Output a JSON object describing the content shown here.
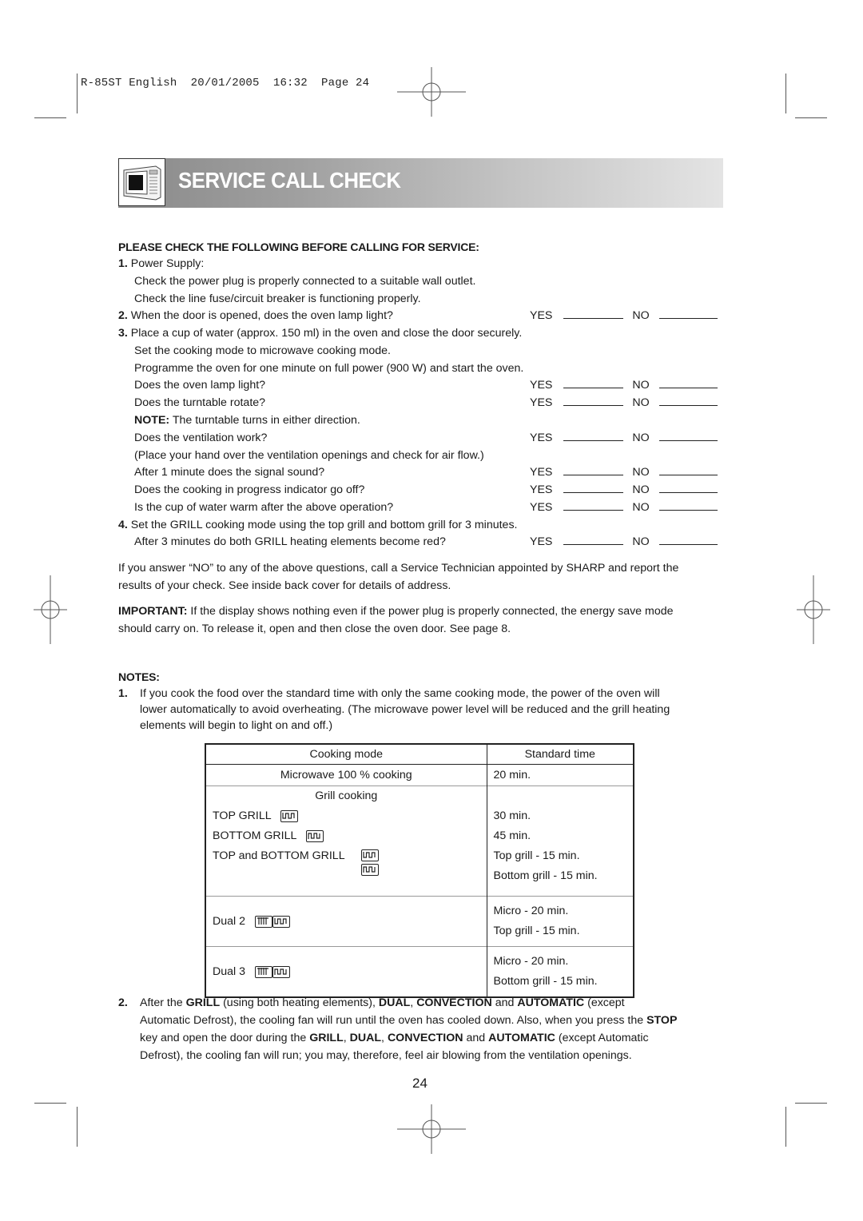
{
  "print_slug": "R-85ST English  20/01/2005  16:32  Page 24",
  "banner": {
    "title": "SERVICE CALL CHECK",
    "icon": "microwave-oven-icon"
  },
  "check": {
    "heading": "PLEASE CHECK THE FOLLOWING BEFORE CALLING FOR SERVICE:",
    "yes_label": "YES",
    "no_label": "NO",
    "items": [
      {
        "num": "1.",
        "lines": [
          "Power Supply:",
          "Check the power plug is properly connected to a suitable wall outlet.",
          "Check the line fuse/circuit breaker is functioning properly."
        ]
      },
      {
        "num": "2.",
        "question": "When the door is opened, does the oven lamp light?"
      },
      {
        "num": "3.",
        "lines": [
          "Place a cup of water (approx. 150 ml) in the oven and close the door securely.",
          "Set the cooking mode to microwave cooking mode.",
          "Programme the oven for one minute on full power (900 W) and start the oven."
        ],
        "questions": [
          "Does the oven lamp light?",
          "Does the turntable rotate?"
        ],
        "note_label": "NOTE:",
        "note_text": " The turntable turns in either direction.",
        "q_ventilation": "Does the ventilation work?",
        "ventilation_hint": "(Place your hand over the ventilation openings and check for air flow.)",
        "questions2": [
          "After 1 minute does the signal sound?",
          "Does the cooking in progress indicator go off?",
          "Is the cup of water warm after the above operation?"
        ]
      },
      {
        "num": "4.",
        "lines": [
          "Set the GRILL cooking mode using the top grill and bottom grill for 3 minutes."
        ],
        "question": "After 3 minutes do both GRILL heating elements become red?"
      }
    ]
  },
  "advice": {
    "line1": "If you answer “NO” to any of the above questions, call a Service Technician appointed by SHARP and report the",
    "line2": "results of your check. See inside back cover for details of address.",
    "important_label": "IMPORTANT:",
    "important_line1": " If the display shows nothing even if the power plug is properly connected, the energy save mode",
    "important_line2": "should carry on. To release it, open and then close the oven door. See page 8."
  },
  "notes": {
    "heading": "NOTES:",
    "note1_num": "1.",
    "note1_lines": [
      "If you cook the food over the standard time with only the same cooking mode, the power of the oven will",
      "lower automatically to avoid overheating. (The microwave power level will be reduced and the grill heating",
      "elements will begin to light on and off.)"
    ],
    "table": {
      "headers": [
        "Cooking mode",
        "Standard time"
      ],
      "microwave": {
        "mode": "Microwave 100 % cooking",
        "time": "20 min."
      },
      "grill_heading": "Grill cooking",
      "top_grill": {
        "mode": "TOP GRILL",
        "time": "30 min.",
        "icon": "top-grill-icon"
      },
      "bottom_grill": {
        "mode": "BOTTOM GRILL",
        "time": "45 min.",
        "icon": "bottom-grill-icon"
      },
      "top_bottom": {
        "mode": "TOP and BOTTOM GRILL",
        "time1": "Top grill - 15 min.",
        "time2": "Bottom grill - 15 min."
      },
      "dual2": {
        "mode": "Dual 2",
        "time1": "Micro - 20 min.",
        "time2": "Top grill - 15 min."
      },
      "dual3": {
        "mode": "Dual 3",
        "time1": "Micro - 20 min.",
        "time2": "Bottom grill - 15 min."
      }
    },
    "note2_num": "2.",
    "note2": {
      "l1a": "After the ",
      "l1b": "GRILL",
      "l1c": " (using both heating elements), ",
      "l1d": "DUAL",
      "l1e": ", ",
      "l1f": "CONVECTION",
      "l1g": " and ",
      "l1h": "AUTOMATIC",
      "l1i": " (except",
      "l2a": "Automatic Defrost), the cooling fan will run until the  oven has cooled down. Also, when you press the ",
      "l2b": "STOP",
      "l3a": "key and open the door during the ",
      "l3b": "GRILL",
      "l3c": ", ",
      "l3d": "DUAL",
      "l3e": ", ",
      "l3f": "CONVECTION",
      "l3g": " and ",
      "l3h": "AUTOMATIC",
      "l3i": " (except Automatic",
      "l4": "Defrost), the cooling fan will run; you may, therefore, feel air blowing from the ventilation openings."
    }
  },
  "page_number": "24"
}
